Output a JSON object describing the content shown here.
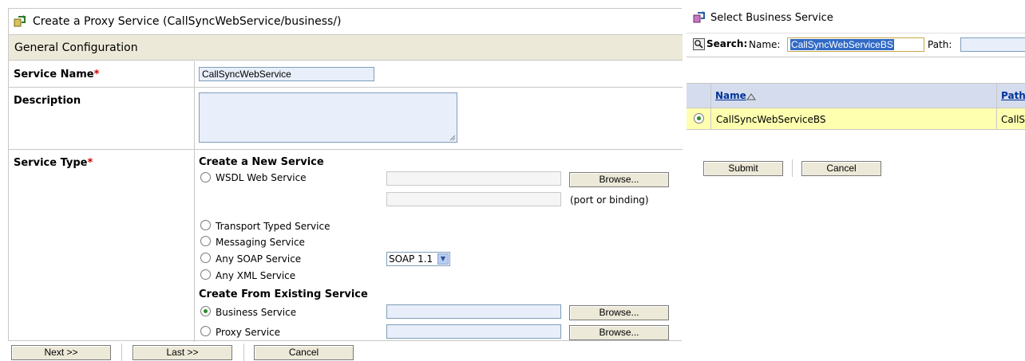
{
  "proxy": {
    "title": "Create a Proxy Service (CallSyncWebService/business/)",
    "section": "General Configuration",
    "service_name_label": "Service Name",
    "service_name_value": "CallSyncWebService",
    "description_label": "Description",
    "service_type_label": "Service Type",
    "required_marker": "*",
    "create_new_title": "Create a New Service",
    "options": {
      "wsdl": "WSDL Web Service",
      "transport": "Transport Typed Service",
      "messaging": "Messaging Service",
      "any_soap": "Any SOAP Service",
      "any_xml": "Any XML Service"
    },
    "port_hint": "(port or binding)",
    "soap_version": "SOAP 1.1",
    "create_existing_title": "Create From Existing Service",
    "existing": {
      "business": "Business Service",
      "proxy": "Proxy Service"
    },
    "browse_label": "Browse...",
    "selected_option": "business",
    "buttons": {
      "next": "Next >>",
      "last": "Last >>",
      "cancel": "Cancel"
    }
  },
  "business_select": {
    "title": "Select Business Service",
    "search_label": "Search:",
    "name_label": "Name:",
    "name_value": "CallSyncWebServiceBS",
    "path_label": "Path:",
    "columns": {
      "name": "Name",
      "path": "Path"
    },
    "rows": [
      {
        "name": "CallSyncWebServiceBS",
        "path": "CallSy"
      }
    ],
    "buttons": {
      "submit": "Submit",
      "cancel": "Cancel"
    }
  }
}
